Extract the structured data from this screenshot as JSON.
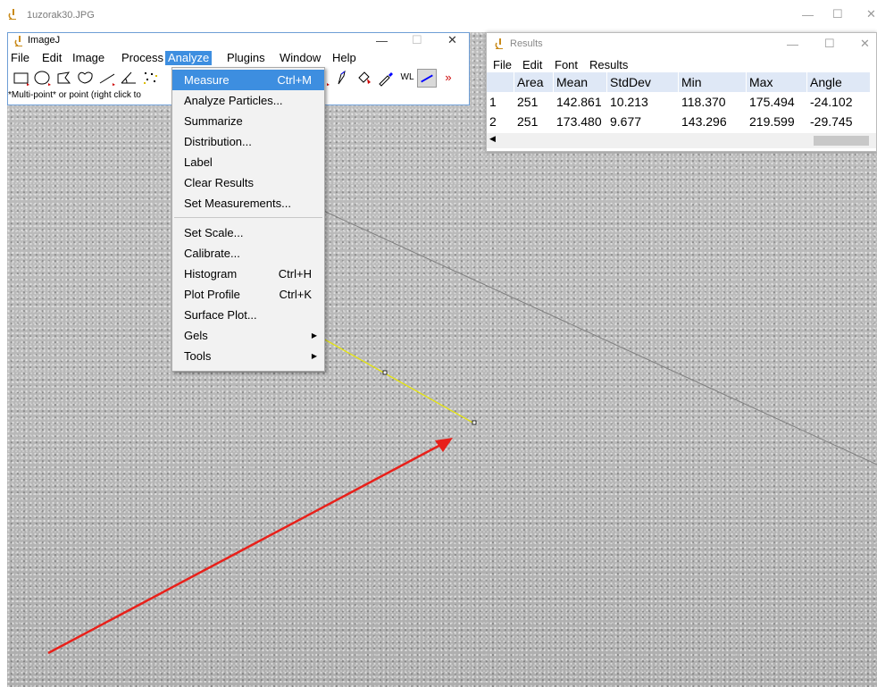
{
  "outer_window": {
    "title": "1uzorak30.JPG"
  },
  "imagej": {
    "title": "ImageJ",
    "menus": [
      "File",
      "Edit",
      "Image",
      "Process",
      "Analyze",
      "Plugins",
      "Window",
      "Help"
    ],
    "active_menu": "Analyze",
    "tools": [
      "rectangle-tool",
      "oval-tool",
      "polygon-tool",
      "freehand-tool",
      "line-tool",
      "angle-tool",
      "multi-point-tool",
      "magnifier-tool",
      "pencil-tool",
      "brush-tool",
      "pipette-tool",
      "wl-tool",
      "line-selection-tool",
      "more-tools"
    ],
    "tool_text_wl": "WL",
    "tool_text_more": "»",
    "status": "*Multi-point* or point (right click to"
  },
  "analyze_menu": {
    "items": [
      {
        "label": "Measure",
        "shortcut": "Ctrl+M",
        "highlighted": true
      },
      {
        "label": "Analyze Particles...",
        "shortcut": ""
      },
      {
        "label": "Summarize",
        "shortcut": ""
      },
      {
        "label": "Distribution...",
        "shortcut": ""
      },
      {
        "label": "Label",
        "shortcut": ""
      },
      {
        "label": "Clear Results",
        "shortcut": ""
      },
      {
        "label": "Set Measurements...",
        "shortcut": ""
      },
      {
        "label": "Set Scale...",
        "shortcut": ""
      },
      {
        "label": "Calibrate...",
        "shortcut": ""
      },
      {
        "label": "Histogram",
        "shortcut": "Ctrl+H"
      },
      {
        "label": "Plot Profile",
        "shortcut": "Ctrl+K"
      },
      {
        "label": "Surface Plot...",
        "shortcut": ""
      },
      {
        "label": "Gels",
        "shortcut": "",
        "submenu": true
      },
      {
        "label": "Tools",
        "shortcut": "",
        "submenu": true
      }
    ]
  },
  "results": {
    "title": "Results",
    "menus": [
      "File",
      "Edit",
      "Font",
      "Results"
    ],
    "columns": [
      "",
      "Area",
      "Mean",
      "StdDev",
      "Min",
      "Max",
      "Angle"
    ],
    "rows": [
      [
        "1",
        "251",
        "142.861",
        "10.213",
        "118.370",
        "175.494",
        "-24.102"
      ],
      [
        "2",
        "251",
        "173.480",
        "9.677",
        "143.296",
        "219.599",
        "-29.745"
      ]
    ]
  },
  "colors": {
    "menu_highlight": "#3d8ee0",
    "selection_line": "#e8e800",
    "annotation_arrow": "#e8201a",
    "table_header": "#dfe8f6"
  }
}
